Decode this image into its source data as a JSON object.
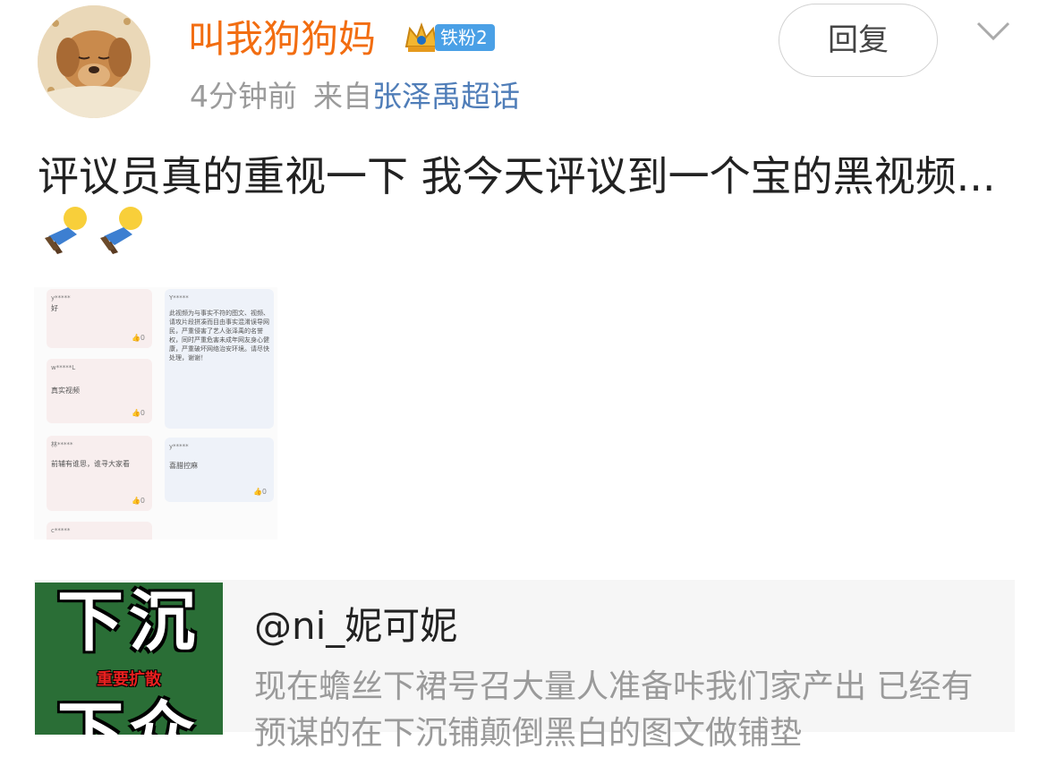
{
  "post": {
    "username": "叫我狗狗妈",
    "fan_badge": "铁粉2",
    "time": "4分钟前",
    "from_label": "来自",
    "source": "张泽禹超话",
    "reply_label": "回复",
    "text": "评议员真的重视一下 我今天评议到一个宝的黑视频..."
  },
  "screenshot_cards": [
    {
      "user": "y*****",
      "body": "好",
      "likes": "0"
    },
    {
      "user": "Y*****",
      "body": "此视频为与事实不符的图文、视频、请攻片段拼凑而目由事实混淆误导网民，严重侵害了艺人张泽禹的名誉权，同时严重危害未成年网友身心健康，严重破坏网络治安环境。请尽快处理，谢谢！",
      "likes": ""
    },
    {
      "user": "w*****L",
      "body": "真实视频",
      "likes": "0"
    },
    {
      "user": "林*****",
      "body": "前辅有谁思，谁寻大家看",
      "likes": "0"
    },
    {
      "user": "y*****",
      "body": "喜腊控麻",
      "likes": "0"
    },
    {
      "user": "c*****",
      "body": "",
      "likes": ""
    }
  ],
  "shared": {
    "image_big_top": "下沉",
    "image_small": "重要扩散",
    "image_big_bottom": "下众",
    "title": "@ni_妮可妮",
    "description": "现在蟾丝下裙号召大量人准备咔我们家产出 已经有预谋的在下沉铺颠倒黑白的图文做铺垫"
  },
  "colors": {
    "username": "#f26d11",
    "source_link": "#4f7db8",
    "badge_bg": "#4aa0e6",
    "share_image_bg": "#2a6e36"
  }
}
